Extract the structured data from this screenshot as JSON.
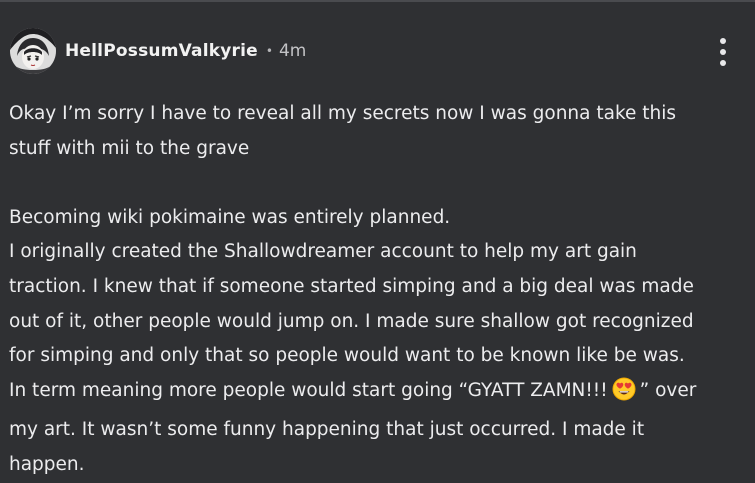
{
  "post": {
    "author": "HellPossumValkyrie",
    "separator": "•",
    "time": "4m",
    "paragraph1": {
      "line1": "Okay I’m sorry I have to reveal all my secrets now I was gonna take this",
      "line2": "stuff with mii to the grave"
    },
    "paragraph2": {
      "line1": "Becoming wiki pokimaine was entirely planned.",
      "line2": "I originally created the Shallowdreamer account to help my art gain",
      "line3": "traction. I knew that if someone started simping and a big deal was made",
      "line4": "out of it, other people would jump on. I made sure shallow got recognized",
      "line5": "for simping and only that so people would want to be known like be was.",
      "line6_before_emoji": "In term meaning more people would start going “GYATT ZAMN!!!",
      "line6_after_emoji": "” over",
      "line7": "my art. It wasn’t some funny happening that just occurred. I made it",
      "line8": "happen."
    },
    "emoji": "heart-eyes-emoji"
  },
  "icons": {
    "more": "more-vertical-icon",
    "avatar": "anime-avatar-image"
  },
  "colors": {
    "background": "#2f3033",
    "text": "#ececee",
    "muted": "#c3c3c6"
  }
}
